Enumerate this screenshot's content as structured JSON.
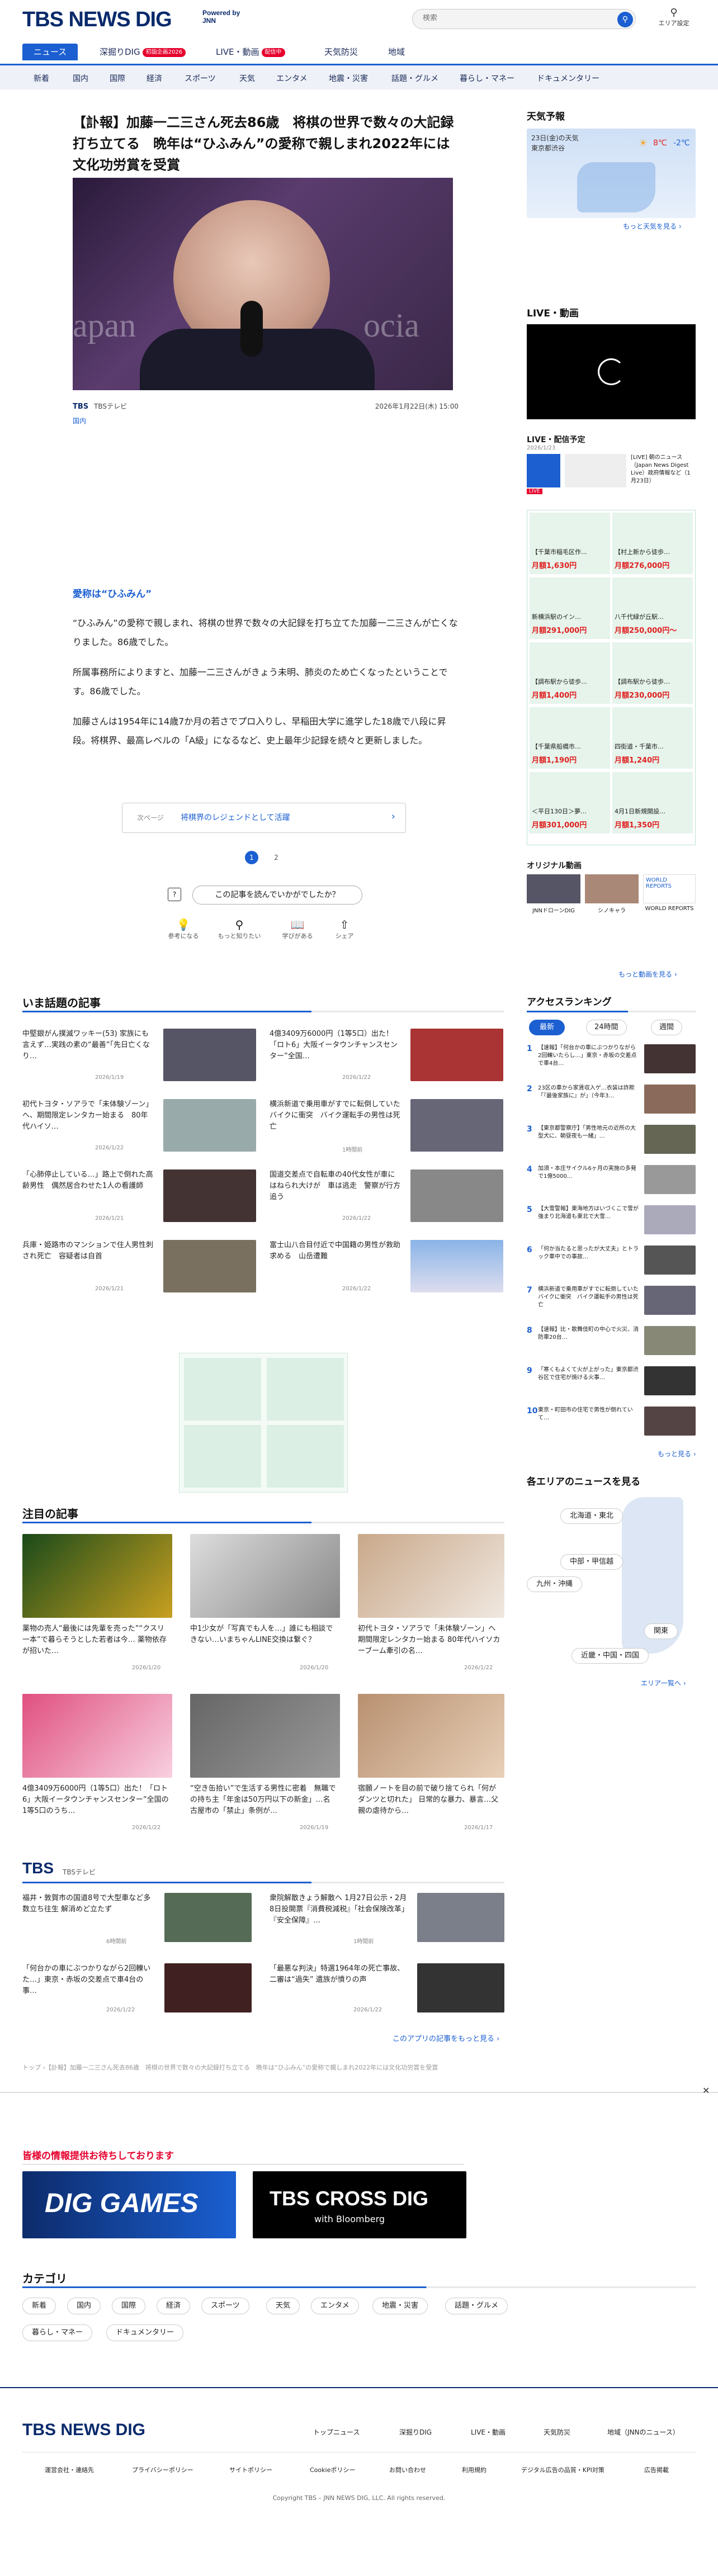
{
  "header": {
    "logo": "TBS NEWS DIG",
    "powered": "Powered by JNN",
    "search_placeholder": "検索",
    "area_label": "エリア設定"
  },
  "nav_main": [
    {
      "label": "ニュース"
    },
    {
      "label": "深掘りDIG",
      "badge": "初詣企画2026"
    },
    {
      "label": "LIVE・動画",
      "badge": "配信中"
    },
    {
      "label": "天気防災"
    },
    {
      "label": "地域"
    }
  ],
  "nav_sub": [
    "新着",
    "国内",
    "国際",
    "経済",
    "スポーツ",
    "天気",
    "エンタメ",
    "地震・災害",
    "話題・グルメ",
    "暮らし・マネー",
    "ドキュメンタリー"
  ],
  "article": {
    "title": "【訃報】加藤一二三さん死去86歳　将棋の世界で数々の大記録打ち立てる　晩年は“ひふみん”の愛称で親しまれ2022年には文化功労賞を受賞",
    "source_logo": "TBS",
    "source": "TBSテレビ",
    "datetime": "2026年1月22日(木) 15:00",
    "category": "国内",
    "subhead": "愛称は“ひふみん”",
    "paragraphs": [
      "“ひふみん”の愛称で親しまれ、将棋の世界で数々の大記録を打ち立てた加藤一二三さんが亡くなりました。86歳でした。",
      "所属事務所によりますと、加藤一二三さんがきょう未明、肺炎のため亡くなったということです。86歳でした。",
      "加藤さんは1954年に14歳7か月の若さでプロ入りし、早稲田大学に進学した18歳で八段に昇段。将棋界、最高レベルの「A級」になるなど、史上最年少記録を続々と更新しました。"
    ],
    "next_page_label": "次ページ",
    "next_page_title": "将棋界のレジェンドとして活躍",
    "pages": [
      "1",
      "2"
    ],
    "feedback_question": "この記事を読んでいかがでしたか？",
    "reactions": [
      "参考になる",
      "もっと知りたい",
      "学びがある",
      "シェア"
    ]
  },
  "trending": {
    "heading": "いま話題の記事",
    "items": [
      {
        "title": "中堅銀がん撲滅ワッキー(53) 家族にも言えず…実践の素の“最善”「先日亡くなり…",
        "date": "2026/1/19"
      },
      {
        "title": "4億3409万6000円（1等5口）出た！「ロト6」大阪イータウンチャンスセンター”全国…",
        "date": "2026/1/22"
      },
      {
        "title": "初代トヨタ・ソアラで「未体験ゾーン」へ、期間限定レンタカー始まる　80年代ハイソ…",
        "date": "2026/1/22"
      },
      {
        "title": "横浜新道で乗用車がすでに転倒していたバイクに衝突　バイク運転手の男性は死亡",
        "date": "1時間前"
      },
      {
        "title": "「心肺停止している…」路上で倒れた高齢男性　偶然居合わせた1人の看護師",
        "date": "2026/1/21"
      },
      {
        "title": "国道交差点で自転車の40代女性が車にはねられ大けが　車は逃走　警察が行方追う",
        "date": "2026/1/22"
      },
      {
        "title": "兵庫・姫路市のマンションで住人男性刺され死亡　容疑者は自首",
        "date": "2026/1/21"
      },
      {
        "title": "富士山八合目付近で中国籍の男性が救助求める　山岳遭難",
        "date": "2026/1/22"
      }
    ]
  },
  "featured": {
    "heading": "注目の記事",
    "items": [
      {
        "title": "薬物の売人“最後には先輩を売った”“クスリ一本”で暮らそうとした若者は今… 薬物依存が招いた…",
        "date": "2026/1/20"
      },
      {
        "title": "中1少女が「写真でも人を…」誰にも相談できない…いまちゃんLINE交換は繋ぐ？",
        "date": "2026/1/20"
      },
      {
        "title": "初代トヨタ・ソアラで「未体験ゾーン」へ 期間限定レンタカー始まる 80年代ハイソカーブーム牽引の名…",
        "date": "2026/1/22"
      },
      {
        "title": "4億3409万6000円（1等5口）出た！「ロト6」大阪イータウンチャンスセンター”全国の1等5口のうち…",
        "date": "2026/1/22"
      },
      {
        "title": "“空き缶拾い”で生活する男性に密着　無職での持ち主「年金は50万円以下の新金」…名古屋市の「禁止」条例が…",
        "date": "2026/1/19"
      },
      {
        "title": "宿願ノートを目の前で破り捨てられ「何がダンツと切れた」 日常的な暴力、暴言…父親の虐待から…",
        "date": "2026/1/17"
      }
    ]
  },
  "tbs": {
    "heading": "TBS",
    "sub": "TBSテレビ",
    "items": [
      {
        "title": "福井・敦賀市の国道8号で大型車など多数立ち往生 解消めど立たず",
        "date": "6時間前"
      },
      {
        "title": "衆院解散きょう解散へ 1月27日公示・2月8日投開票『消費税減税』「社会保険改革」『安全保障』…",
        "date": "1時間前"
      },
      {
        "title": "「何台かの車にぶつかりながら2回轢いた…」東京・赤坂の交差点で車4台の事…",
        "date": "2026/1/22"
      },
      {
        "title": "「最悪な判決」特選1964年の死亡事故、二審は“過失” 遺族が憤りの声",
        "date": "2026/1/22"
      }
    ],
    "more": "このアプリの記事をもっと見る ›"
  },
  "breadcrumb": "トップ ›【訃報】加藤一二三さん死去86歳　将棋の世界で数々の大記録打ち立てる　晩年は“ひふみん”の愛称で親しまれ2022年には文化功労賞を受賞",
  "promo": {
    "heading": "皆様の情報提供お待ちしております",
    "banner1": "DIG GAMES",
    "banner2": "TBS CROSS DIG",
    "banner2_sub": "with Bloomberg"
  },
  "categories": {
    "heading": "カテゴリ",
    "items": [
      "新着",
      "国内",
      "国際",
      "経済",
      "スポーツ",
      "天気",
      "エンタメ",
      "地震・災害",
      "話題・グルメ",
      "暮らし・マネー",
      "ドキュメンタリー"
    ]
  },
  "footer": {
    "logo": "TBS NEWS DIG",
    "nav": [
      "トップニュース",
      "深掘りDIG",
      "LIVE・動画",
      "天気防災",
      "地域（JNNのニュース）"
    ],
    "links": [
      "運営会社・連絡先",
      "プライバシーポリシー",
      "サイトポリシー",
      "Cookieポリシー",
      "お問い合わせ",
      "利用規約",
      "デジタル広告の品質・KPI対策",
      "広告掲載"
    ],
    "copyright": "Copyright TBS – JNN NEWS DIG, LLC. All rights reserved."
  },
  "sidebar": {
    "weather_heading": "天気予報",
    "weather_date": "23日(金)の天気",
    "weather_place": "東京都渋谷",
    "weather_temp_hi": "8℃",
    "weather_temp_lo": "-2℃",
    "weather_more": "もっと天気を見る ›",
    "live_heading": "LIVE・動画",
    "live_schedule_heading": "LIVE・配信予定",
    "live_item_date": "2026/1/23",
    "live_item_tag": "LIVE",
    "live_item_title": "[LIVE] 朝のニュース（Japan News Digest Live）政府情報など（1月23日）",
    "ad_items": [
      {
        "title": "【千葉市稲毛区作…",
        "price": "月額1,630円"
      },
      {
        "title": "【村上新から徒歩…",
        "price": "月額276,000円"
      },
      {
        "title": "新横浜駅のイン…",
        "price": "月額291,000円"
      },
      {
        "title": "八千代緑が丘駅…",
        "price": "月額250,000円〜"
      },
      {
        "title": "【調布駅から徒歩…",
        "price": "月額1,400円"
      },
      {
        "title": "【調布駅から徒歩…",
        "price": "月額230,000円"
      },
      {
        "title": "【千葉県船橋市…",
        "price": "月額1,190円"
      },
      {
        "title": "四街道・千葉市…",
        "price": "月額1,240円"
      },
      {
        "title": "＜平日130日＞夢…",
        "price": "月額301,000円"
      },
      {
        "title": "4月1日新規開設…",
        "price": "月額1,350円"
      }
    ],
    "original_heading": "オリジナル動画",
    "originals": [
      {
        "title": "JNNドローンDIG"
      },
      {
        "title": "シノキャラ"
      },
      {
        "title": "WORLD REPORTS"
      }
    ],
    "original_more": "もっと動画を見る ›",
    "ranking_heading": "アクセスランキング",
    "ranking_tabs": [
      "最新",
      "24時間",
      "週間"
    ],
    "ranking": [
      "【速報】「何台かの車にぶつかりながら2回轢いたらし…」東京・赤坂の交差点で車4台…",
      "23区の車から家賃収入ゲ…衣装は詐欺「『最後家族に』が」（今年3…",
      "【東京都警察庁】「男性地元の近所の大型犬に、朝昼夜も一緒」…",
      "加須・本庄サイクル6ヶ月の実施の多発で1億5000…",
      "【大雪警報】東海地方はいづくこで雪が強まり北海道も東北で大雪…",
      "「何か当たると思ったが大丈夫」とトラック車中での事故…",
      "横浜新道で乗用車がすでに転倒していたバイクに衝突　バイク運転手の男性は死亡",
      "【速報】比・歌舞伎町の中心で火災、消防車20台…",
      "「寒くもよくて火が上がった」東京都渋谷区で住宅が焼ける火事…",
      "東京・町田市の住宅で男性が倒れていて…"
    ],
    "ranking_more": "もっと見る ›",
    "area_heading": "各エリアのニュースを見る",
    "area_buttons": [
      "北海道・東北",
      "中部・甲信越",
      "九州・沖縄",
      "関東",
      "近畿・中国・四国"
    ],
    "area_more": "エリア一覧へ ›"
  },
  "colors": {
    "brand": "#0a2a6b",
    "accent": "#1b5fd1",
    "live_red": "#e6002d",
    "ad_green": "#2e9e6e",
    "price_red": "#e02020"
  }
}
